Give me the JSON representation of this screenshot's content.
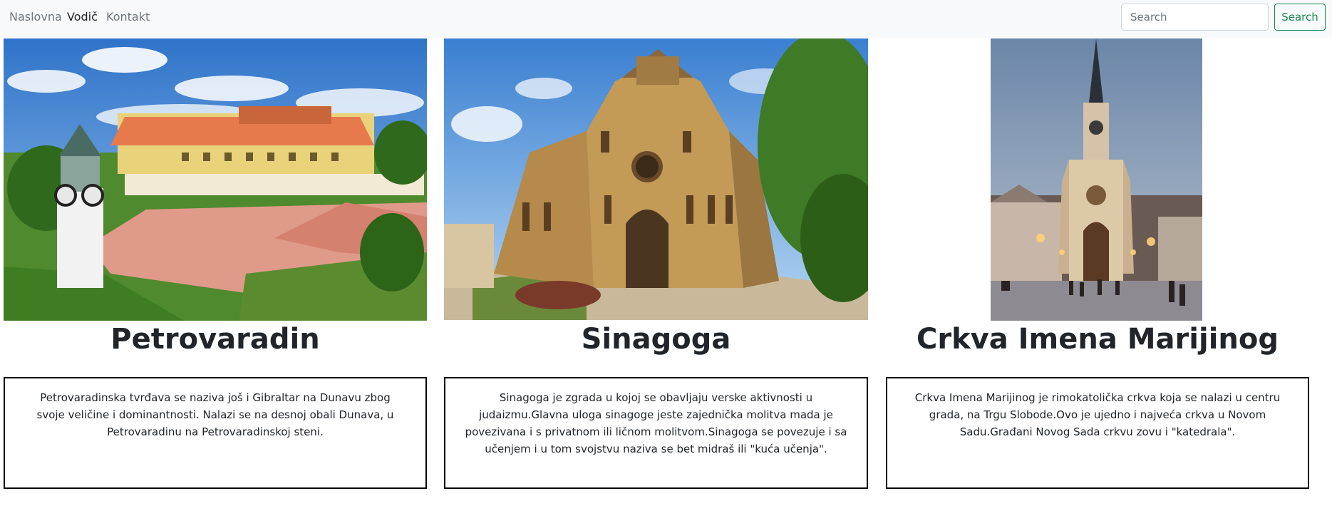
{
  "nav": {
    "items": [
      {
        "label": "Naslovna"
      },
      {
        "label": "Vodič"
      },
      {
        "label": "Kontakt"
      }
    ],
    "search": {
      "placeholder": "Search",
      "button_label": "Search"
    }
  },
  "cards": [
    {
      "title": "Petrovaradin",
      "description": "Petrovaradinska tvrđava se naziva još i Gibraltar na Dunavu zbog svoje veličine i dominantnosti. Nalazi se na desnoj obali Dunava, u Petrovaradinu na Petrovaradinskoj steni."
    },
    {
      "title": "Sinagoga",
      "description": "Sinagoga je zgrada u kojoj se obavljaju verske aktivnosti u judaizmu.Glavna uloga sinagoge jeste zajednička molitva mada je povezivana i s privatnom ili ličnom molitvom.Sinagoga se povezuje i sa učenjem i u tom svojstvu naziva se bet midraš ili \"kuća učenja\"."
    },
    {
      "title": "Crkva Imena Marijinog",
      "description": "Crkva Imena Marijinog je rimokatolička crkva koja se nalazi u centru grada, na Trgu Slobode.Ovo je ujedno i najveća crkva u Novom Sadu.Građani Novog Sada crkvu zovu i \"katedrala\"."
    }
  ],
  "colors": {
    "navbar_bg": "#f8f9fa",
    "accent": "#198754",
    "text": "#212529",
    "muted": "#6c757d"
  }
}
